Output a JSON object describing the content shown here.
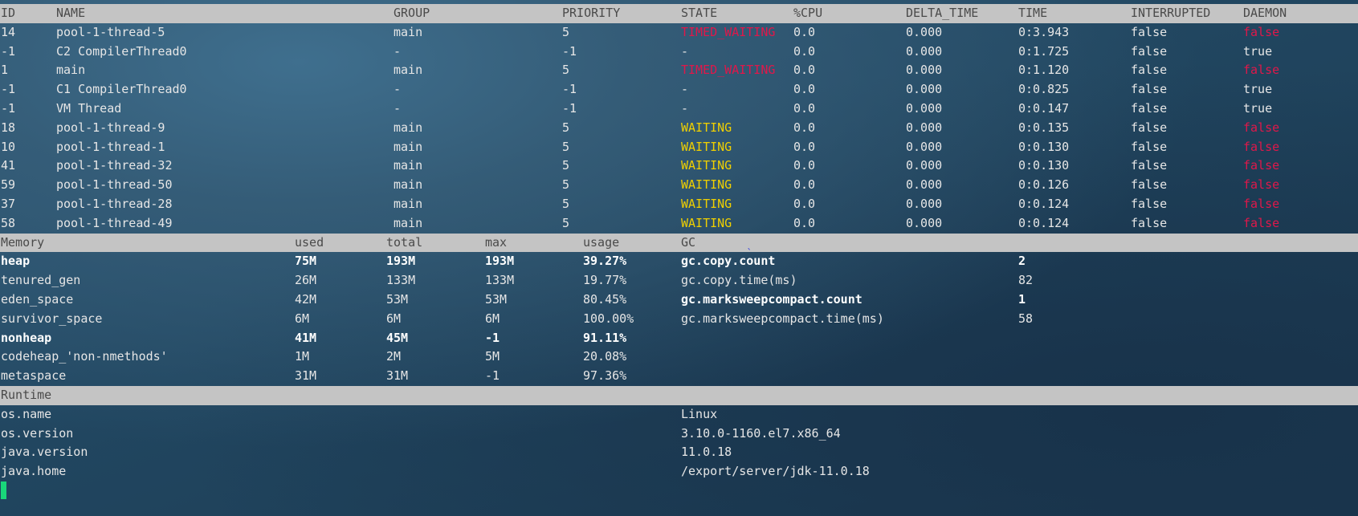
{
  "threads": {
    "headers": [
      "ID",
      "NAME",
      "GROUP",
      "PRIORITY",
      "STATE",
      "%CPU",
      "DELTA_TIME",
      "TIME",
      "INTERRUPTED",
      "DAEMON"
    ],
    "rows": [
      {
        "id": "14",
        "name": "pool-1-thread-5",
        "group": "main",
        "priority": "5",
        "state": "TIMED_WAITING",
        "cpu": "0.0",
        "delta": "0.000",
        "time": "0:3.943",
        "interrupted": "false",
        "daemon": "false"
      },
      {
        "id": "-1",
        "name": "C2 CompilerThread0",
        "group": "-",
        "priority": "-1",
        "state": "-",
        "cpu": "0.0",
        "delta": "0.000",
        "time": "0:1.725",
        "interrupted": "false",
        "daemon": "true"
      },
      {
        "id": "1",
        "name": "main",
        "group": "main",
        "priority": "5",
        "state": "TIMED_WAITING",
        "cpu": "0.0",
        "delta": "0.000",
        "time": "0:1.120",
        "interrupted": "false",
        "daemon": "false"
      },
      {
        "id": "-1",
        "name": "C1 CompilerThread0",
        "group": "-",
        "priority": "-1",
        "state": "-",
        "cpu": "0.0",
        "delta": "0.000",
        "time": "0:0.825",
        "interrupted": "false",
        "daemon": "true"
      },
      {
        "id": "-1",
        "name": "VM Thread",
        "group": "-",
        "priority": "-1",
        "state": "-",
        "cpu": "0.0",
        "delta": "0.000",
        "time": "0:0.147",
        "interrupted": "false",
        "daemon": "true"
      },
      {
        "id": "18",
        "name": "pool-1-thread-9",
        "group": "main",
        "priority": "5",
        "state": "WAITING",
        "cpu": "0.0",
        "delta": "0.000",
        "time": "0:0.135",
        "interrupted": "false",
        "daemon": "false"
      },
      {
        "id": "10",
        "name": "pool-1-thread-1",
        "group": "main",
        "priority": "5",
        "state": "WAITING",
        "cpu": "0.0",
        "delta": "0.000",
        "time": "0:0.130",
        "interrupted": "false",
        "daemon": "false"
      },
      {
        "id": "41",
        "name": "pool-1-thread-32",
        "group": "main",
        "priority": "5",
        "state": "WAITING",
        "cpu": "0.0",
        "delta": "0.000",
        "time": "0:0.130",
        "interrupted": "false",
        "daemon": "false"
      },
      {
        "id": "59",
        "name": "pool-1-thread-50",
        "group": "main",
        "priority": "5",
        "state": "WAITING",
        "cpu": "0.0",
        "delta": "0.000",
        "time": "0:0.126",
        "interrupted": "false",
        "daemon": "false"
      },
      {
        "id": "37",
        "name": "pool-1-thread-28",
        "group": "main",
        "priority": "5",
        "state": "WAITING",
        "cpu": "0.0",
        "delta": "0.000",
        "time": "0:0.124",
        "interrupted": "false",
        "daemon": "false"
      },
      {
        "id": "58",
        "name": "pool-1-thread-49",
        "group": "main",
        "priority": "5",
        "state": "WAITING",
        "cpu": "0.0",
        "delta": "0.000",
        "time": "0:0.124",
        "interrupted": "false",
        "daemon": "false"
      }
    ]
  },
  "memory": {
    "headers": [
      "Memory",
      "used",
      "total",
      "max",
      "usage",
      "GC"
    ],
    "rows": [
      {
        "name": "heap",
        "used": "75M",
        "total": "193M",
        "max": "193M",
        "usage": "39.27%",
        "bold": true
      },
      {
        "name": "tenured_gen",
        "used": "26M",
        "total": "133M",
        "max": "133M",
        "usage": "19.77%",
        "bold": false
      },
      {
        "name": "eden_space",
        "used": "42M",
        "total": "53M",
        "max": "53M",
        "usage": "80.45%",
        "bold": false
      },
      {
        "name": "survivor_space",
        "used": "6M",
        "total": "6M",
        "max": "6M",
        "usage": "100.00%",
        "bold": false
      },
      {
        "name": "nonheap",
        "used": "41M",
        "total": "45M",
        "max": "-1",
        "usage": "91.11%",
        "bold": true
      },
      {
        "name": "codeheap_'non-nmethods'",
        "used": "1M",
        "total": "2M",
        "max": "5M",
        "usage": "20.08%",
        "bold": false
      },
      {
        "name": "metaspace",
        "used": "31M",
        "total": "31M",
        "max": "-1",
        "usage": "97.36%",
        "bold": false
      }
    ],
    "gc": [
      {
        "name": "gc.copy.count",
        "value": "2",
        "bold": true
      },
      {
        "name": "gc.copy.time(ms)",
        "value": "82",
        "bold": false
      },
      {
        "name": "gc.marksweepcompact.count",
        "value": "1",
        "bold": true
      },
      {
        "name": "gc.marksweepcompact.time(ms)",
        "value": "58",
        "bold": false
      }
    ]
  },
  "runtime": {
    "header": "Runtime",
    "rows": [
      {
        "key": "os.name",
        "value": "Linux"
      },
      {
        "key": "os.version",
        "value": "3.10.0-1160.el7.x86_64"
      },
      {
        "key": "java.version",
        "value": "11.0.18"
      },
      {
        "key": "java.home",
        "value": "/export/server/jdk-11.0.18"
      }
    ]
  },
  "colors": {
    "timed_waiting": "#e0174a",
    "waiting": "#f0d000",
    "daemon_false": "#e0174a",
    "cursor": "#19d67a",
    "header_bg": "#c4c4c4"
  },
  "icons": {
    "cursor": "block-cursor-icon",
    "artifact": "blue-tick-icon"
  }
}
